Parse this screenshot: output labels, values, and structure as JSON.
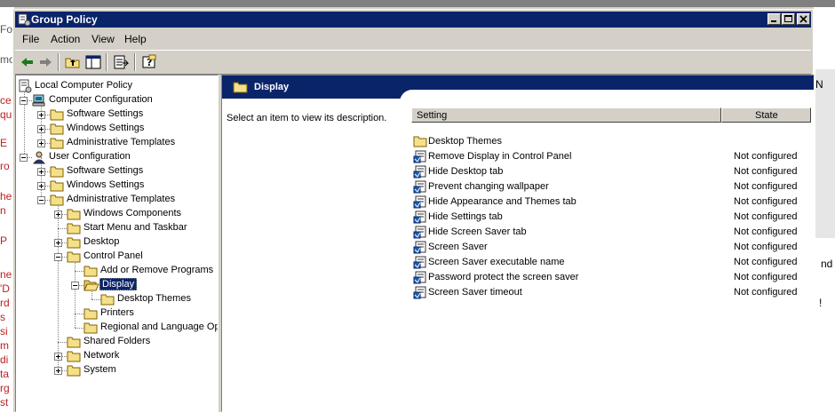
{
  "window": {
    "title": "Group Policy"
  },
  "menu": {
    "file": "File",
    "action": "Action",
    "view": "View",
    "help": "Help"
  },
  "tree": {
    "root": "Local Computer Policy",
    "computer_configuration": "Computer Configuration",
    "cc_software": "Software Settings",
    "cc_windows": "Windows Settings",
    "cc_admin": "Administrative Templates",
    "user_configuration": "User Configuration",
    "uc_software": "Software Settings",
    "uc_windows": "Windows Settings",
    "uc_admin": "Administrative Templates",
    "windows_components": "Windows Components",
    "start_menu": "Start Menu and Taskbar",
    "desktop": "Desktop",
    "control_panel": "Control Panel",
    "add_remove": "Add or Remove Programs",
    "display": "Display",
    "desktop_themes": "Desktop Themes",
    "printers": "Printers",
    "regional": "Regional and Language Op",
    "shared_folders": "Shared Folders",
    "network": "Network",
    "system": "System"
  },
  "details": {
    "header_title": "Display",
    "description": "Select an item to view its description.",
    "columns": {
      "setting": "Setting",
      "state": "State"
    },
    "rows": [
      {
        "name": "Desktop Themes",
        "state": "",
        "type": "folder"
      },
      {
        "name": "Remove Display in Control Panel",
        "state": "Not configured",
        "type": "policy"
      },
      {
        "name": "Hide Desktop tab",
        "state": "Not configured",
        "type": "policy"
      },
      {
        "name": "Prevent changing wallpaper",
        "state": "Not configured",
        "type": "policy"
      },
      {
        "name": "Hide Appearance and Themes tab",
        "state": "Not configured",
        "type": "policy"
      },
      {
        "name": "Hide Settings tab",
        "state": "Not configured",
        "type": "policy"
      },
      {
        "name": "Hide Screen Saver tab",
        "state": "Not configured",
        "type": "policy"
      },
      {
        "name": "Screen Saver",
        "state": "Not configured",
        "type": "policy"
      },
      {
        "name": "Screen Saver executable name",
        "state": "Not configured",
        "type": "policy"
      },
      {
        "name": "Password protect the screen saver",
        "state": "Not configured",
        "type": "policy"
      },
      {
        "name": "Screen Saver timeout",
        "state": "Not configured",
        "type": "policy"
      }
    ]
  },
  "background": {
    "left_fragments": [
      "Fo",
      "mo",
      "ce",
      "qu",
      "E",
      "ro",
      "he",
      "n",
      "P",
      "ne",
      "'D",
      "rd",
      "s",
      "si",
      "m",
      "di",
      "ta",
      "rg",
      "st"
    ],
    "right_fragments": [
      "N",
      "nd",
      "!"
    ]
  },
  "colors": {
    "titlebar": "#0a246a",
    "face": "#d4d0c8",
    "folder": "#f5e08a"
  }
}
